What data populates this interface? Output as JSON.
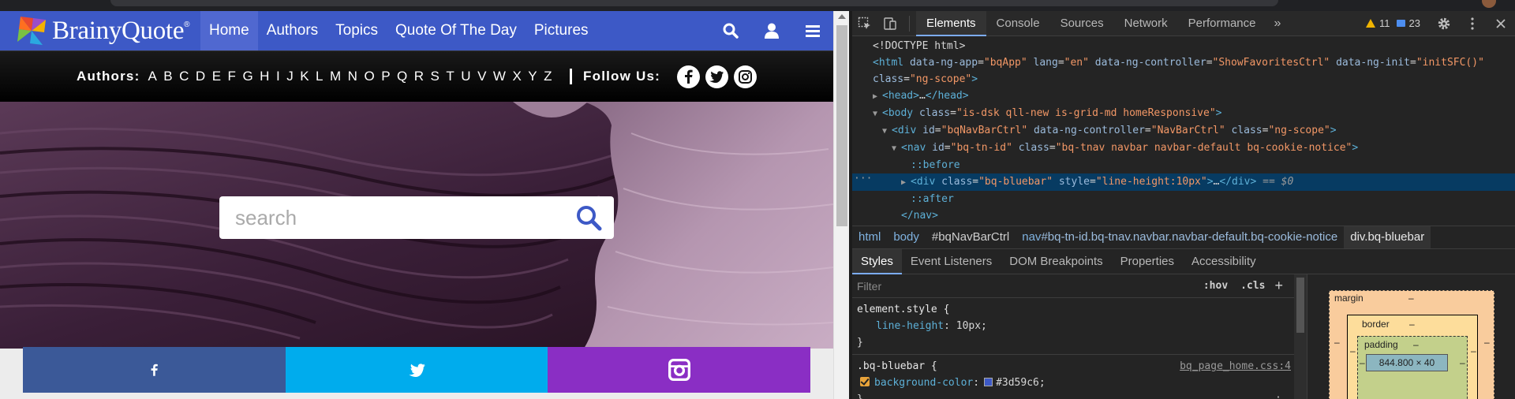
{
  "site": {
    "logo_text": "BrainyQuote",
    "logo_reg": "®",
    "nav": [
      {
        "label": "Home"
      },
      {
        "label": "Authors"
      },
      {
        "label": "Topics"
      },
      {
        "label": "Quote Of The Day"
      },
      {
        "label": "Pictures"
      }
    ],
    "authors_label": "Authors:",
    "letters": [
      "A",
      "B",
      "C",
      "D",
      "E",
      "F",
      "G",
      "H",
      "I",
      "J",
      "K",
      "L",
      "M",
      "N",
      "O",
      "P",
      "Q",
      "R",
      "S",
      "T",
      "U",
      "V",
      "W",
      "X",
      "Y",
      "Z"
    ],
    "follow_label": "Follow Us:",
    "search_placeholder": "search",
    "brand_color": "#3d59c6",
    "share_colors": {
      "facebook": "#3b5998",
      "twitter": "#00aced",
      "instagram": "#8a2ec4"
    }
  },
  "devtools": {
    "tabs": [
      "Elements",
      "Console",
      "Sources",
      "Network",
      "Performance"
    ],
    "more": "»",
    "warnings": "11",
    "messages": "23",
    "dom_lines": [
      {
        "indent": 0,
        "tri": "",
        "html": "<span class='txt'>&lt;!DOCTYPE html&gt;</span>"
      },
      {
        "indent": 0,
        "tri": "",
        "html": "<span class='tag'>&lt;html</span> <span class='attr'>data-ng-app</span>=<span class='val'>\"bqApp\"</span> <span class='attr'>lang</span>=<span class='val'>\"en\"</span> <span class='attr'>data-ng-controller</span>=<span class='val'>\"ShowFavoritesCtrl\"</span> <span class='attr'>data-ng-init</span>=<span class='val'>\"initSFC()\"</span>"
      },
      {
        "indent": 0,
        "tri": "",
        "html": "<span class='attr'>class</span>=<span class='val'>\"ng-scope\"</span><span class='tag'>&gt;</span>"
      },
      {
        "indent": 1,
        "tri": "▶",
        "html": "<span class='tag'>&lt;head&gt;</span><span class='txt'>…</span><span class='tag'>&lt;/head&gt;</span>"
      },
      {
        "indent": 1,
        "tri": "▼",
        "html": "<span class='tag'>&lt;body</span> <span class='attr'>class</span>=<span class='val'>\"is-dsk qll-new is-grid-md homeResponsive\"</span><span class='tag'>&gt;</span>"
      },
      {
        "indent": 2,
        "tri": "▼",
        "html": "<span class='tag'>&lt;div</span> <span class='attr'>id</span>=<span class='val'>\"bqNavBarCtrl\"</span> <span class='attr'>data-ng-controller</span>=<span class='val'>\"NavBarCtrl\"</span> <span class='attr'>class</span>=<span class='val'>\"ng-scope\"</span><span class='tag'>&gt;</span>"
      },
      {
        "indent": 3,
        "tri": "▼",
        "html": "<span class='tag'>&lt;nav</span> <span class='attr'>id</span>=<span class='val'>\"bq-tn-id\"</span> <span class='attr'>class</span>=<span class='val'>\"bq-tnav navbar navbar-default bq-cookie-notice\"</span><span class='tag'>&gt;</span>"
      },
      {
        "indent": 4,
        "tri": "",
        "html": "<span class='pseudo'>::before</span>"
      },
      {
        "indent": 4,
        "tri": "▶",
        "sel": true,
        "html": "<span class='tag'>&lt;div</span> <span class='attr'>class</span>=<span class='val'>\"bq-bluebar\"</span> <span class='attr'>style</span>=<span class='val'>\"line-height:10px\"</span><span class='tag'>&gt;</span><span class='txt'>…</span><span class='tag'>&lt;/div&gt;</span> <span class='eq'>== $0</span>"
      },
      {
        "indent": 4,
        "tri": "",
        "html": "<span class='pseudo'>::after</span>"
      },
      {
        "indent": 3,
        "tri": "",
        "html": "<span class='tag'>&lt;/nav&gt;</span>"
      }
    ],
    "breadcrumbs": [
      {
        "tag": "html",
        "rest": ""
      },
      {
        "tag": "body",
        "rest": ""
      },
      {
        "tag": "",
        "rest": "#bqNavBarCtrl"
      },
      {
        "tag": "nav",
        "rest": "#bq-tn-id.bq-tnav.navbar.navbar-default.bq-cookie-notice"
      },
      {
        "tag": "div",
        "rest": ".bq-bluebar"
      }
    ],
    "panel_tabs": [
      "Styles",
      "Event Listeners",
      "DOM Breakpoints",
      "Properties",
      "Accessibility"
    ],
    "filter_placeholder": "Filter",
    "hov": ":hov",
    "cls": ".cls",
    "element_style_selector": "element.style {",
    "element_style_prop": "line-height",
    "element_style_value": "10px;",
    "rule_selector": ".bq-bluebar {",
    "rule_source": "bq_page_home.css:4",
    "rule_prop": "background-color",
    "rule_value": "#3d59c6;",
    "close_brace": "}",
    "box": {
      "margin_label": "margin",
      "border_label": "border",
      "padding_label": "padding",
      "content": "844.800 × 40",
      "dash": "–"
    }
  }
}
